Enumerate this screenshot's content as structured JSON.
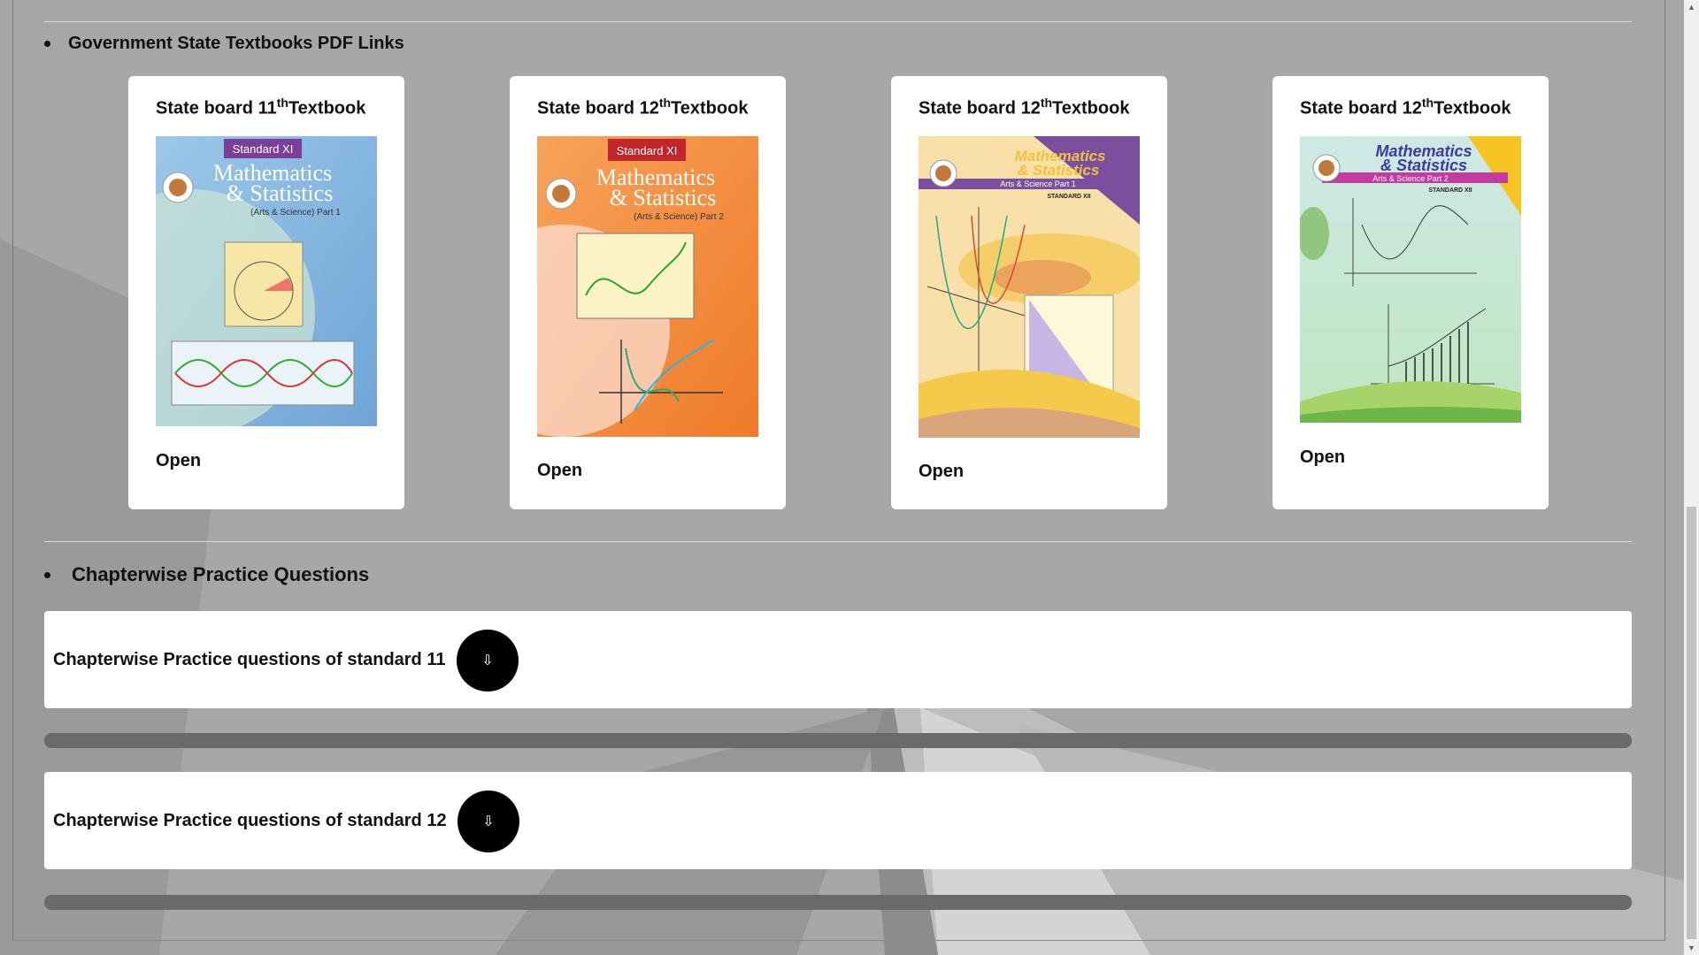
{
  "sections": {
    "textbooks_heading": "Government State Textbooks PDF Links",
    "practice_heading": "Chapterwise Practice Questions"
  },
  "textbooks": [
    {
      "title_prefix": "State board 11",
      "sup": "th",
      "title_suffix": "Textbook",
      "open_label": "Open",
      "cover": {
        "standard": "Standard XI",
        "line1": "Mathematics",
        "line2": "& Statistics",
        "sub": "(Arts & Science)  Part 1"
      }
    },
    {
      "title_prefix": "State board 12",
      "sup": "th",
      "title_suffix": "Textbook",
      "open_label": "Open",
      "cover": {
        "standard": "Standard XI",
        "line1": "Mathematics",
        "line2": "& Statistics",
        "sub": "(Arts & Science)  Part 2"
      }
    },
    {
      "title_prefix": "State board 12",
      "sup": "th",
      "title_suffix": "Textbook",
      "open_label": "Open",
      "cover": {
        "line1": "Mathematics",
        "line2": "& Statistics",
        "sub": "Arts & Science Part 1",
        "standard": "STANDARD XII"
      }
    },
    {
      "title_prefix": "State board 12",
      "sup": "th",
      "title_suffix": "Textbook",
      "open_label": "Open",
      "cover": {
        "line1": "Mathematics",
        "line2": "& Statistics",
        "sub": "Arts & Science Part 2",
        "standard": "STANDARD XII"
      }
    }
  ],
  "practice": [
    {
      "label": "Chapterwise Practice questions of standard 11",
      "button_icon": "⇩"
    },
    {
      "label": "Chapterwise Practice questions of standard 12",
      "button_icon": "⇩"
    }
  ],
  "colors": {
    "page_bg": "#a7a7a7",
    "card_bg": "#ffffff",
    "button_bg": "#000000",
    "progress_bar": "#6a6a6a"
  },
  "icons": {
    "download": "download-arrow-icon",
    "logo": "textbook-bureau-logo-icon"
  }
}
